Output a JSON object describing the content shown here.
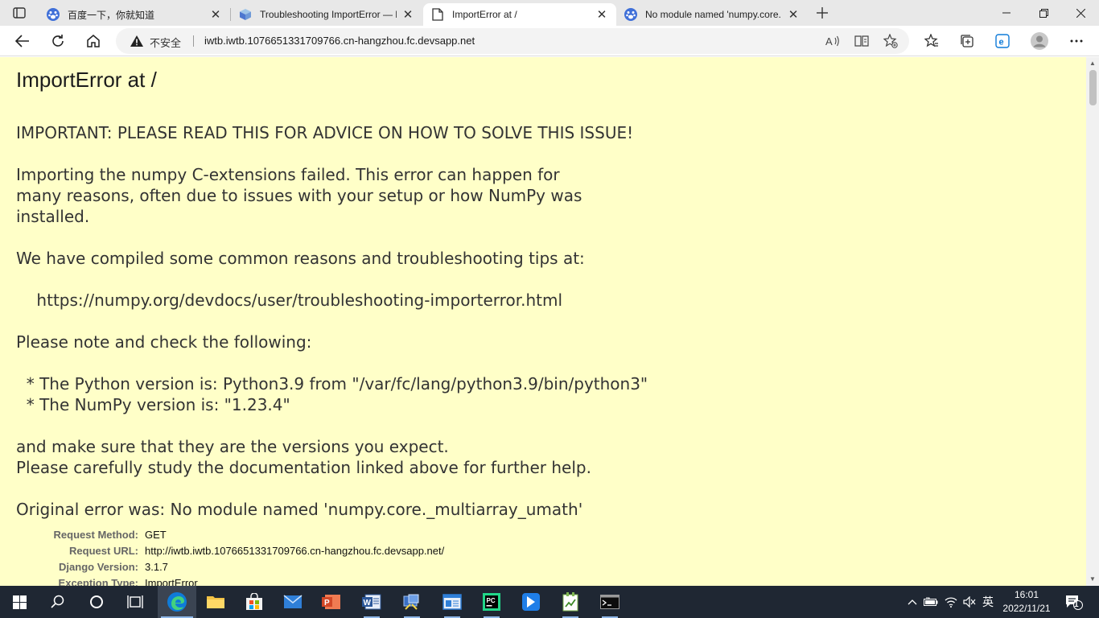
{
  "browser": {
    "tabs": [
      {
        "title": "百度一下，你就知道",
        "icon": "baidu-paw-icon"
      },
      {
        "title": "Troubleshooting ImportError — N",
        "icon": "numpy-cube-icon"
      },
      {
        "title": "ImportError at /",
        "icon": "document-icon"
      },
      {
        "title": "No module named 'numpy.core.",
        "icon": "baidu-paw-icon"
      }
    ],
    "active_tab_index": 2,
    "address": {
      "security_label": "不安全",
      "url": "iwtb.iwtb.1076651331709766.cn-hangzhou.fc.devsapp.net"
    }
  },
  "page": {
    "title": "ImportError at /",
    "exception_value": "IMPORTANT: PLEASE READ THIS FOR ADVICE ON HOW TO SOLVE THIS ISSUE!\n\nImporting the numpy C-extensions failed. This error can happen for\nmany reasons, often due to issues with your setup or how NumPy was\ninstalled.\n\nWe have compiled some common reasons and troubleshooting tips at:\n\n    https://numpy.org/devdocs/user/troubleshooting-importerror.html\n\nPlease note and check the following:\n\n  * The Python version is: Python3.9 from \"/var/fc/lang/python3.9/bin/python3\"\n  * The NumPy version is: \"1.23.4\"\n\nand make sure that they are the versions you expect.\nPlease carefully study the documentation linked above for further help.\n\nOriginal error was: No module named 'numpy.core._multiarray_umath'",
    "meta": [
      {
        "label": "Request Method:",
        "value": "GET"
      },
      {
        "label": "Request URL:",
        "value": "http://iwtb.iwtb.1076651331709766.cn-hangzhou.fc.devsapp.net/"
      },
      {
        "label": "Django Version:",
        "value": "3.1.7"
      },
      {
        "label": "Exception Type:",
        "value": "ImportError"
      }
    ]
  },
  "taskbar": {
    "input_indicator": "英",
    "clock_time": "16:01",
    "clock_date": "2022/11/21",
    "notification_count": "1"
  },
  "colors": {
    "page_background": "#ffffc8",
    "tab_strip": "#e8e8e8",
    "taskbar": "#1f2733",
    "edge_accent": "#0f7bd8"
  }
}
